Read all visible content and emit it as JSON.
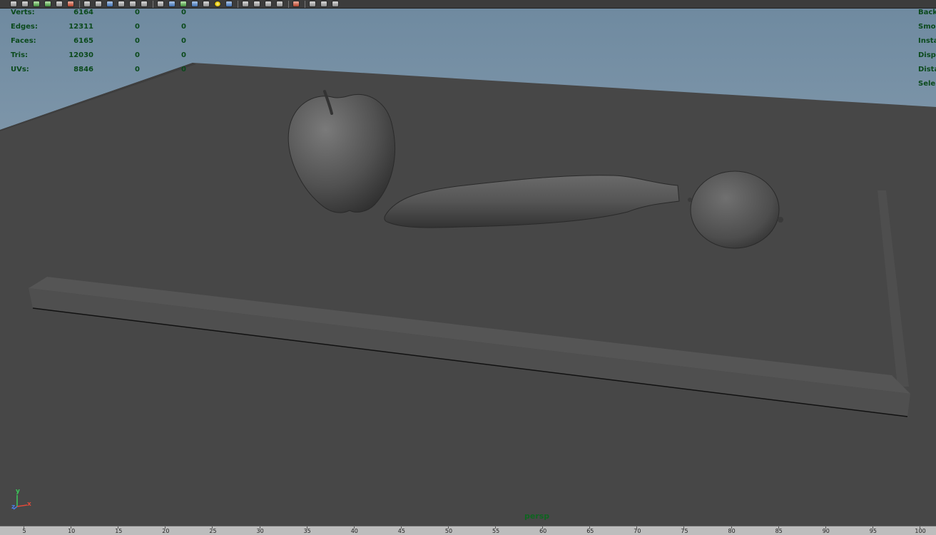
{
  "toolbar": {
    "icons": [
      "select-tool-icon",
      "lasso-tool-icon",
      "paint-select-icon",
      "move-tool-icon",
      "rotate-tool-icon",
      "scale-tool-icon",
      "camera-attributes-icon",
      "bookmark-icon",
      "image-plane-icon",
      "2d-pan-zoom-icon",
      "grease-pencil-icon",
      "grid-icon",
      "wireframe-icon",
      "smooth-shade-icon",
      "shade-all-icon",
      "textured-icon",
      "use-default-lighting-icon",
      "shadows-icon",
      "screen-space-ao-icon",
      "motion-blur-icon",
      "anti-alias-icon",
      "depth-of-field-icon",
      "isolate-select-icon",
      "xray-icon",
      "xray-joints-icon",
      "backface-culling-icon"
    ]
  },
  "hud": {
    "stats": [
      {
        "label": "Verts:",
        "values": [
          "6164",
          "0",
          "0"
        ]
      },
      {
        "label": "Edges:",
        "values": [
          "12311",
          "0",
          "0"
        ]
      },
      {
        "label": "Faces:",
        "values": [
          "6165",
          "0",
          "0"
        ]
      },
      {
        "label": "Tris:",
        "values": [
          "12030",
          "0",
          "0"
        ]
      },
      {
        "label": "UVs:",
        "values": [
          "8846",
          "0",
          "0"
        ]
      }
    ],
    "right": [
      "Back",
      "Smo",
      "Insta",
      "Disp",
      "Dista",
      "Sele"
    ]
  },
  "camera": {
    "name": "persp"
  },
  "axis": {
    "x": "x",
    "y": "y",
    "z": "z"
  },
  "timeline": {
    "ticks": [
      "5",
      "10",
      "15",
      "20",
      "25",
      "30",
      "35",
      "40",
      "45",
      "50",
      "55",
      "60",
      "65",
      "70",
      "75",
      "80",
      "85",
      "90",
      "95",
      "100"
    ]
  },
  "colors": {
    "sky_top": "#6f8aa0",
    "sky_bottom": "#a9b9c6",
    "ground": "#474747",
    "hud_text": "#0b4a1c",
    "camera_label": "#0f6420"
  }
}
